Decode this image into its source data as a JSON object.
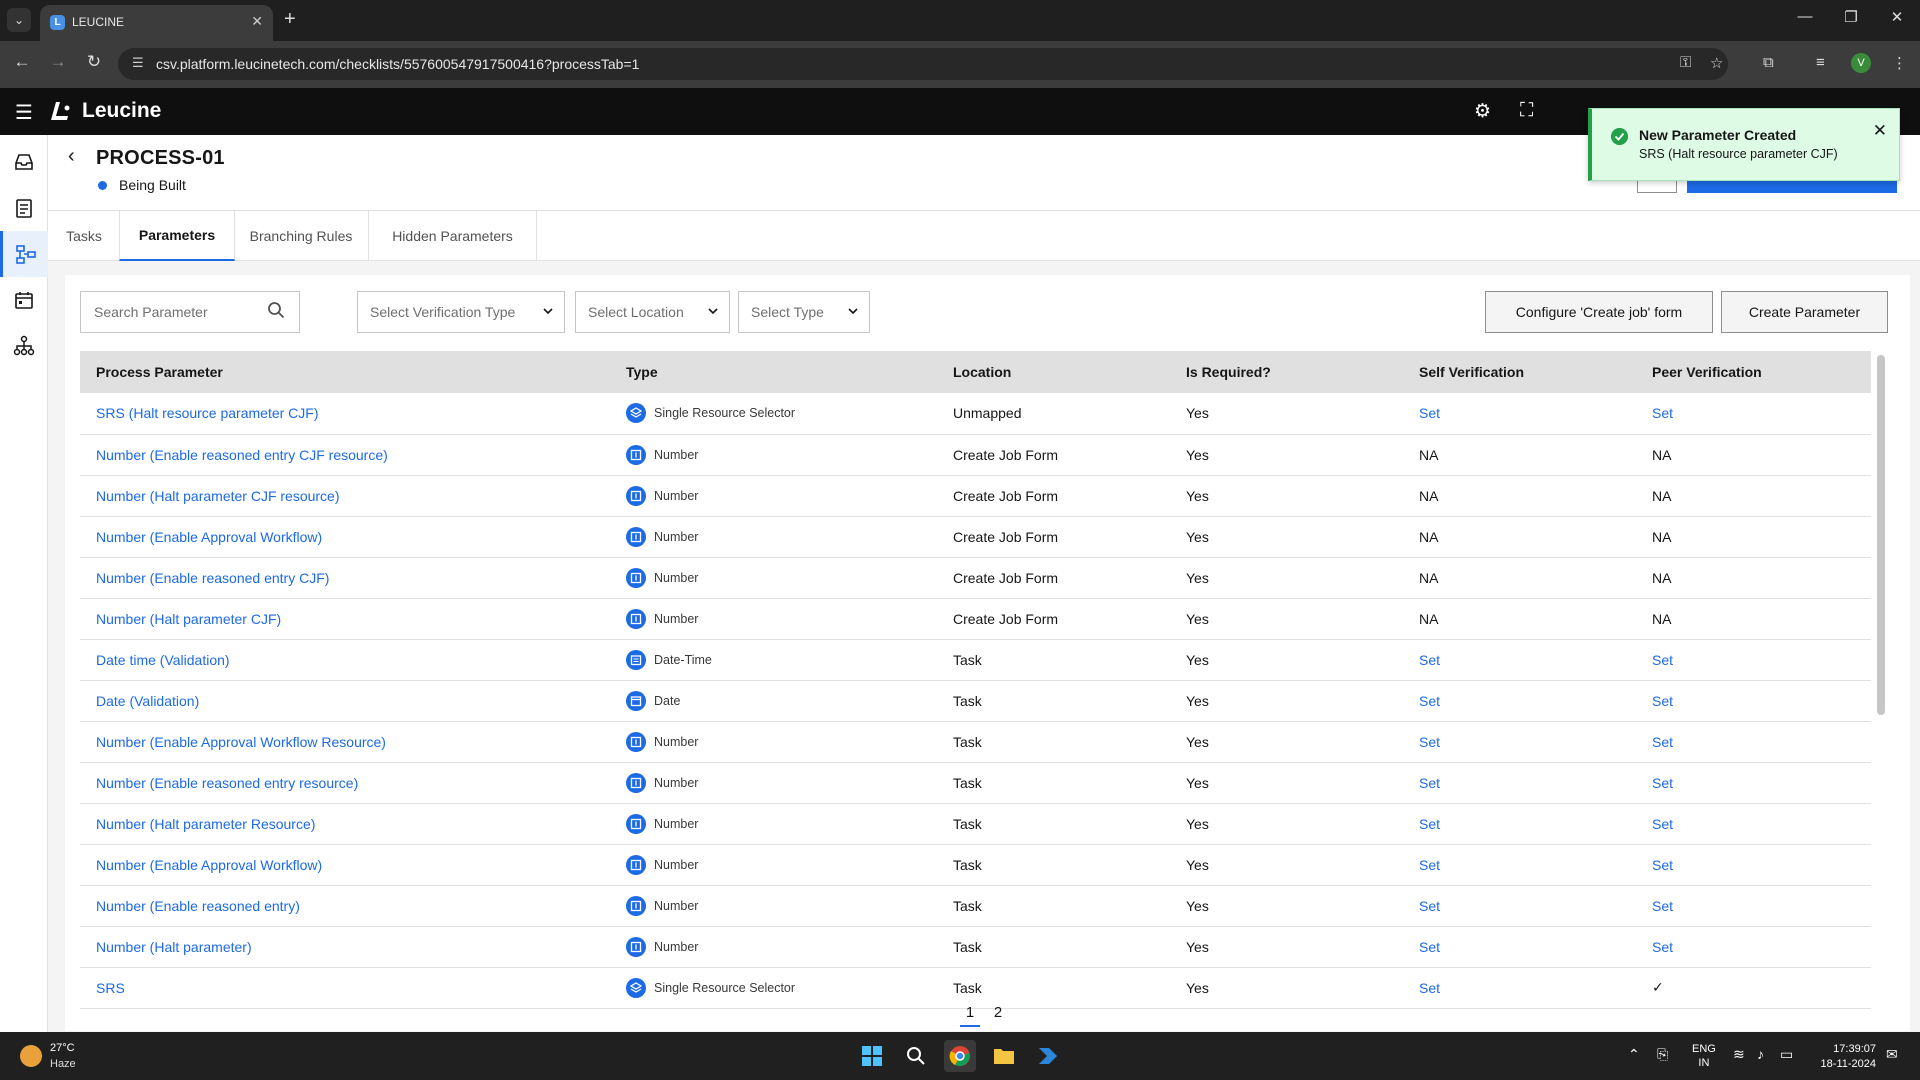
{
  "browser": {
    "tab_title": "LEUCINE",
    "url": "csv.platform.leucinetech.com/checklists/557600547917500416?processTab=1"
  },
  "app": {
    "logo_text": "Leucine"
  },
  "process": {
    "title": "PROCESS-01",
    "status": "Being Built",
    "status_color": "#1d6ae5"
  },
  "tabs": [
    {
      "label": "Tasks",
      "active": false
    },
    {
      "label": "Parameters",
      "active": true
    },
    {
      "label": "Branching Rules",
      "active": false
    },
    {
      "label": "Hidden Parameters",
      "active": false
    }
  ],
  "filters": {
    "search_placeholder": "Search Parameter",
    "verification_type": "Select Verification Type",
    "location": "Select Location",
    "type": "Select Type"
  },
  "actions": {
    "configure_label": "Configure 'Create job' form",
    "create_label": "Create Parameter"
  },
  "table": {
    "columns": [
      "Process Parameter",
      "Type",
      "Location",
      "Is Required?",
      "Self Verification",
      "Peer Verification"
    ],
    "rows": [
      {
        "name": "SRS (Halt resource parameter CJF)",
        "type": "Single Resource Selector",
        "type_icon": "resource-icon",
        "location": "Unmapped",
        "required": "Yes",
        "self": "Set",
        "peer": "Set"
      },
      {
        "name": "Number (Enable reasoned entry CJF resource)",
        "type": "Number",
        "type_icon": "number-icon",
        "location": "Create Job Form",
        "required": "Yes",
        "self": "NA",
        "peer": "NA"
      },
      {
        "name": "Number (Halt parameter CJF resource)",
        "type": "Number",
        "type_icon": "number-icon",
        "location": "Create Job Form",
        "required": "Yes",
        "self": "NA",
        "peer": "NA"
      },
      {
        "name": "Number (Enable Approval Workflow)",
        "type": "Number",
        "type_icon": "number-icon",
        "location": "Create Job Form",
        "required": "Yes",
        "self": "NA",
        "peer": "NA"
      },
      {
        "name": "Number (Enable reasoned entry CJF)",
        "type": "Number",
        "type_icon": "number-icon",
        "location": "Create Job Form",
        "required": "Yes",
        "self": "NA",
        "peer": "NA"
      },
      {
        "name": "Number (Halt parameter CJF)",
        "type": "Number",
        "type_icon": "number-icon",
        "location": "Create Job Form",
        "required": "Yes",
        "self": "NA",
        "peer": "NA"
      },
      {
        "name": "Date time (Validation)",
        "type": "Date-Time",
        "type_icon": "datetime-icon",
        "location": "Task",
        "required": "Yes",
        "self": "Set",
        "peer": "Set"
      },
      {
        "name": "Date (Validation)",
        "type": "Date",
        "type_icon": "date-icon",
        "location": "Task",
        "required": "Yes",
        "self": "Set",
        "peer": "Set"
      },
      {
        "name": "Number (Enable Approval Workflow Resource)",
        "type": "Number",
        "type_icon": "number-icon",
        "location": "Task",
        "required": "Yes",
        "self": "Set",
        "peer": "Set"
      },
      {
        "name": "Number (Enable reasoned entry resource)",
        "type": "Number",
        "type_icon": "number-icon",
        "location": "Task",
        "required": "Yes",
        "self": "Set",
        "peer": "Set"
      },
      {
        "name": "Number (Halt parameter Resource)",
        "type": "Number",
        "type_icon": "number-icon",
        "location": "Task",
        "required": "Yes",
        "self": "Set",
        "peer": "Set"
      },
      {
        "name": "Number (Enable Approval Workflow)",
        "type": "Number",
        "type_icon": "number-icon",
        "location": "Task",
        "required": "Yes",
        "self": "Set",
        "peer": "Set"
      },
      {
        "name": "Number (Enable reasoned entry)",
        "type": "Number",
        "type_icon": "number-icon",
        "location": "Task",
        "required": "Yes",
        "self": "Set",
        "peer": "Set"
      },
      {
        "name": "Number (Halt parameter)",
        "type": "Number",
        "type_icon": "number-icon",
        "location": "Task",
        "required": "Yes",
        "self": "Set",
        "peer": "Set"
      },
      {
        "name": "SRS",
        "type": "Single Resource Selector",
        "type_icon": "resource-icon",
        "location": "Task",
        "required": "Yes",
        "self": "Set",
        "peer": "✓"
      }
    ]
  },
  "pagination": {
    "pages": [
      "1",
      "2"
    ],
    "current": "1"
  },
  "toast": {
    "title": "New Parameter Created",
    "message": "SRS (Halt resource parameter CJF)",
    "color": "#24a148"
  },
  "taskbar": {
    "temperature": "27°C",
    "weather": "Haze",
    "lang_1": "ENG",
    "lang_2": "IN",
    "time": "17:39:07",
    "date": "18-11-2024"
  }
}
